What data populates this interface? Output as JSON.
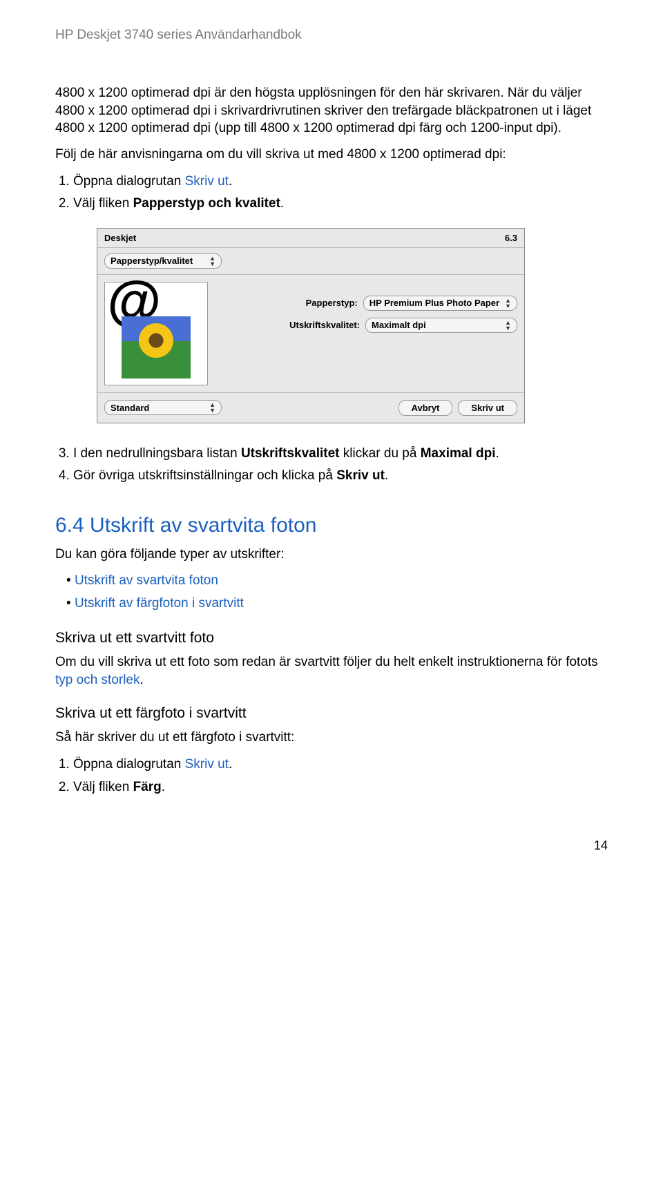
{
  "header": "HP Deskjet 3740 series Användarhandbok",
  "para1a": "4800 x 1200 optimerad dpi är den högsta upplösningen för den här skrivaren. När du väljer 4800 x 1200 optimerad dpi i skrivardrivrutinen skriver den trefärgade bläckpatronen ut i läget 4800 x 1200 optimerad dpi (upp till 4800 x 1200 optimerad dpi färg och 1200-input dpi).",
  "para2": "Följ de här anvisningarna om du vill skriva ut med 4800 x 1200 optimerad dpi:",
  "list1": {
    "i1a": "Öppna dialogrutan ",
    "i1b_link": "Skriv ut",
    "i1c": ".",
    "i2a": "Välj fliken ",
    "i2b_bold": "Papperstyp och kvalitet",
    "i2c": "."
  },
  "dialog": {
    "title": "Deskjet",
    "version": "6.3",
    "tab": "Papperstyp/kvalitet",
    "label_paper": "Papperstyp:",
    "value_paper": "HP Premium Plus Photo Paper",
    "label_quality": "Utskriftskvalitet:",
    "value_quality": "Maximalt dpi",
    "btn_standard": "Standard",
    "btn_cancel": "Avbryt",
    "btn_print": "Skriv ut"
  },
  "list2": {
    "i3a": "I den nedrullningsbara listan ",
    "i3b_bold": "Utskriftskvalitet",
    "i3c": " klickar du på ",
    "i3d_bold": "Maximal dpi",
    "i3e": ".",
    "i4a": "Gör övriga utskriftsinställningar och klicka på ",
    "i4b_bold": "Skriv ut",
    "i4c": "."
  },
  "section": {
    "num": "6.4 ",
    "title": "Utskrift av svartvita foton",
    "intro": "Du kan göra följande typer av utskrifter:",
    "bullet1": "Utskrift av svartvita foton",
    "bullet2": "Utskrift av färgfoton i svartvitt",
    "sub1": "Skriva ut ett svartvitt foto",
    "sub1_text_a": "Om du vill skriva ut ett foto som redan är svartvitt följer du helt enkelt instruktionerna för fotots ",
    "sub1_text_link": "typ och storlek",
    "sub1_text_c": ".",
    "sub2": "Skriva ut ett färgfoto i svartvitt",
    "sub2_intro": "Så här skriver du ut ett färgfoto i svartvitt:",
    "sub2_i1a": "Öppna dialogrutan ",
    "sub2_i1b": "Skriv ut",
    "sub2_i1c": ".",
    "sub2_i2a": "Välj fliken ",
    "sub2_i2b": "Färg",
    "sub2_i2c": "."
  },
  "page_number": "14"
}
